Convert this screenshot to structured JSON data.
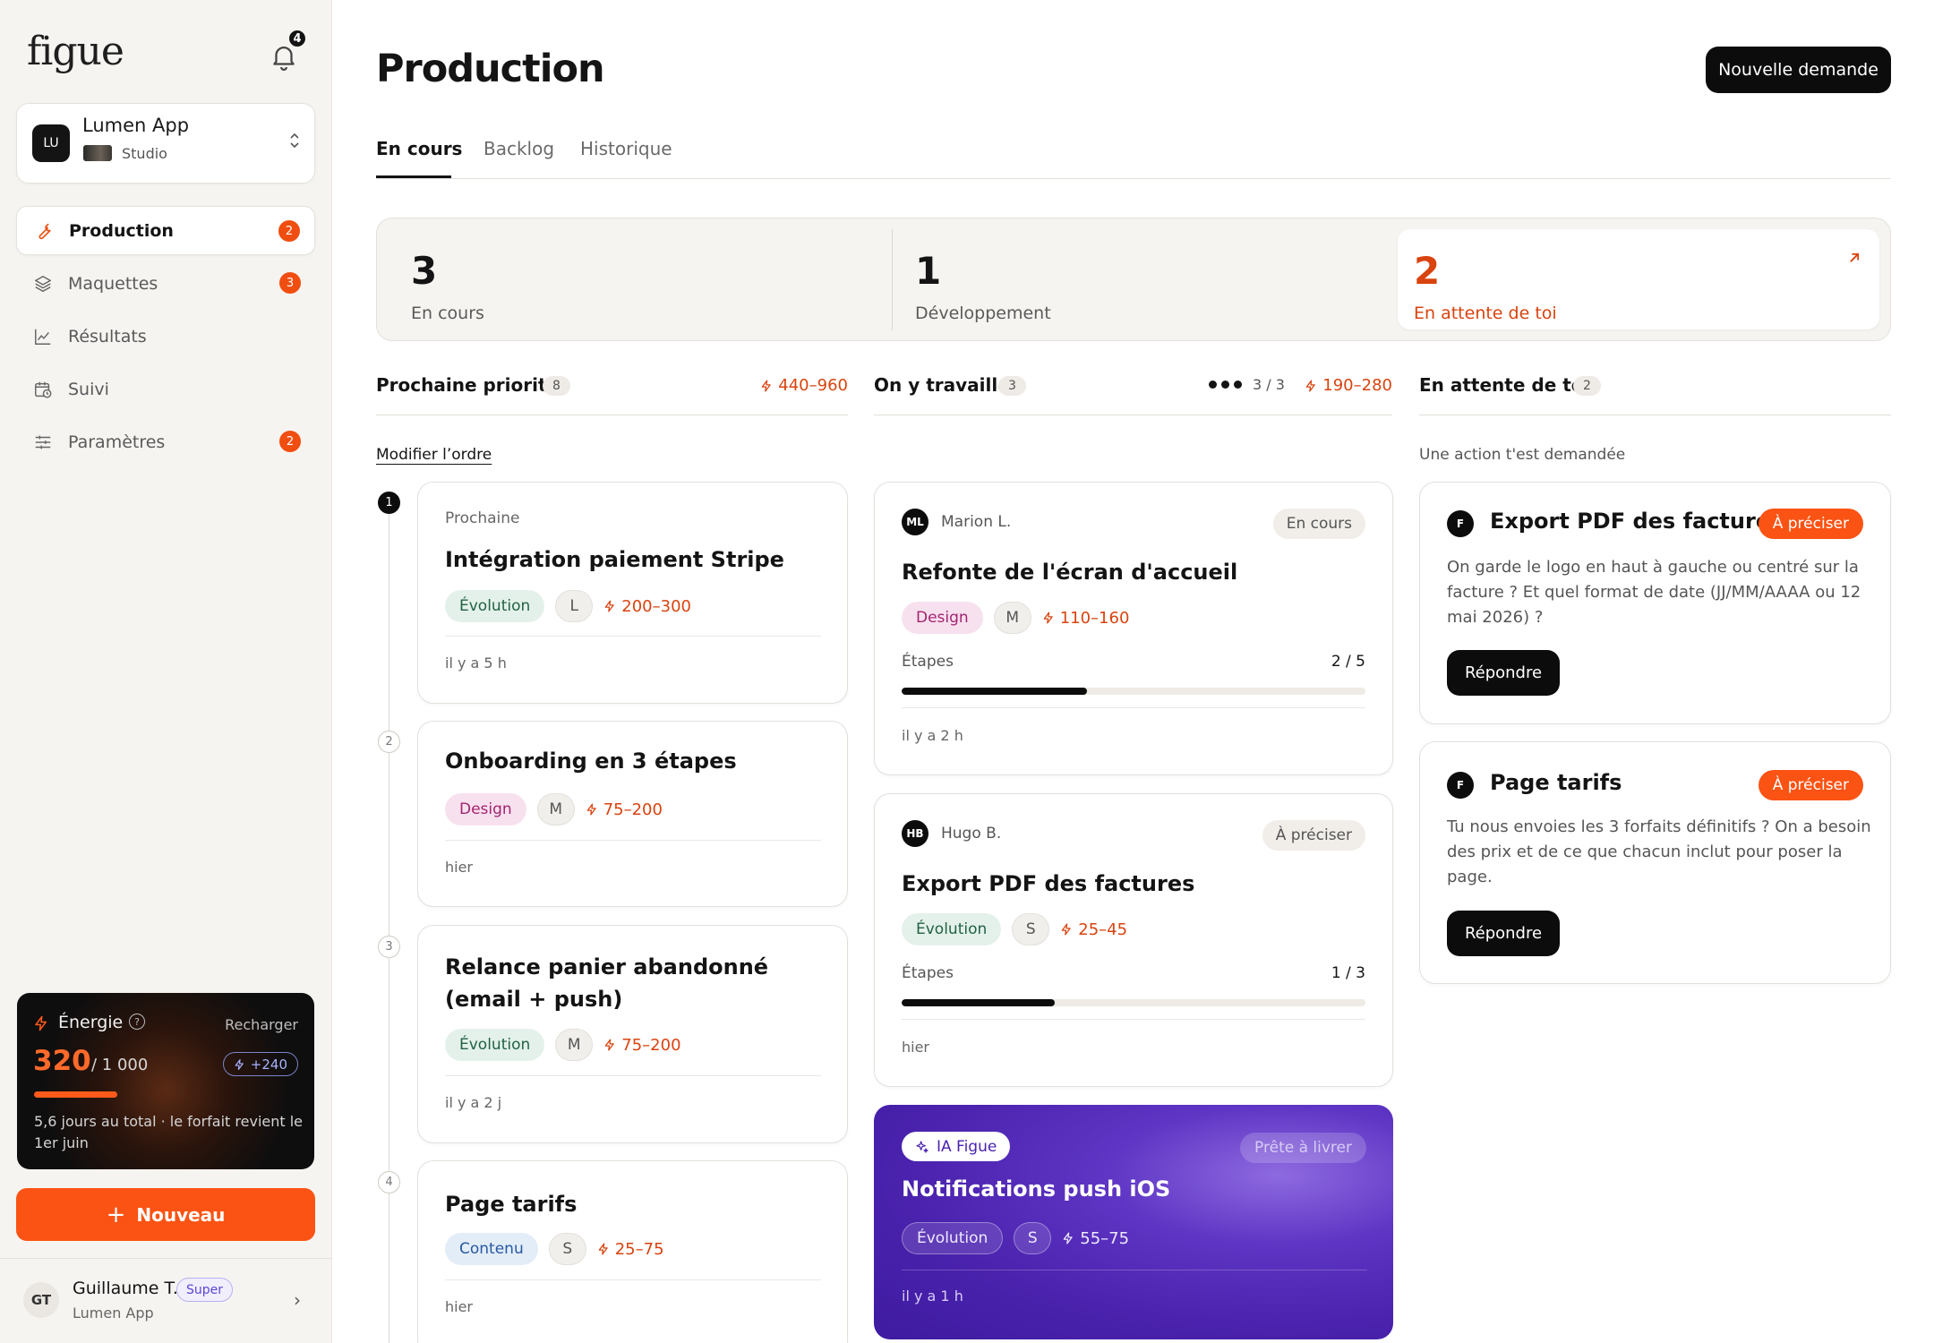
{
  "app": {
    "logo": "figue",
    "notifications_count": "4"
  },
  "workspace": {
    "initials": "LU",
    "name": "Lumen App",
    "plan": "Studio"
  },
  "sidebar": {
    "items": [
      {
        "label": "Production",
        "icon": "wrench-icon",
        "badge": "2",
        "active": true
      },
      {
        "label": "Maquettes",
        "icon": "layers-icon",
        "badge": "3"
      },
      {
        "label": "Résultats",
        "icon": "chart-icon",
        "badge": ""
      },
      {
        "label": "Suivi",
        "icon": "calendar-clock-icon",
        "badge": ""
      },
      {
        "label": "Paramètres",
        "icon": "sliders-icon",
        "badge": "2"
      }
    ]
  },
  "energy": {
    "title": "Énergie",
    "recharge": "Recharger",
    "value": "320",
    "max": "/ 1 000",
    "bonus": "+240",
    "level_fraction": 0.32,
    "note": "5,6 jours au total · le forfait revient le 1er juin"
  },
  "new_button": "Nouveau",
  "user": {
    "initials": "GT",
    "name": "Guillaume T.",
    "tag": "Super",
    "org": "Lumen App"
  },
  "page": {
    "title": "Production",
    "primary_action": "Nouvelle demande",
    "tabs": [
      "En cours",
      "Backlog",
      "Historique"
    ]
  },
  "stats": [
    {
      "value": "3",
      "label": "En cours"
    },
    {
      "value": "1",
      "label": "Développement"
    },
    {
      "value": "2",
      "label": "En attente de toi"
    }
  ],
  "columns": {
    "next": {
      "title": "Prochaine priorité",
      "count": "8",
      "range": "440–960",
      "action": "Modifier l’ordre",
      "cards": [
        {
          "rank": "1",
          "kicker": "Prochaine",
          "title": "Intégration paiement Stripe",
          "type": "Évolution",
          "size": "L",
          "range": "200–300",
          "time": "il y a 5 h"
        },
        {
          "rank": "2",
          "title": "Onboarding en 3 étapes",
          "type": "Design",
          "size": "M",
          "range": "75–200",
          "time": "hier"
        },
        {
          "rank": "3",
          "title": "Relance panier abandonné (email + push)",
          "type": "Évolution",
          "size": "M",
          "range": "75–200",
          "time": "il y a 2 j"
        },
        {
          "rank": "4",
          "title": "Page tarifs",
          "type": "Contenu",
          "size": "S",
          "range": "25–75",
          "time": "hier"
        }
      ]
    },
    "working": {
      "title": "On y travaille",
      "count": "3",
      "progress": "3 / 3",
      "range": "190–280",
      "cards": [
        {
          "initials": "ML",
          "person": "Marion L.",
          "status": "En cours",
          "title": "Refonte de l'écran d'accueil",
          "type": "Design",
          "size": "M",
          "range": "110–160",
          "steps_label": "Étapes",
          "steps": "2 / 5",
          "steps_fraction": 0.4,
          "time": "il y a 2 h"
        },
        {
          "initials": "HB",
          "person": "Hugo B.",
          "status": "À préciser",
          "title": "Export PDF des factures",
          "type": "Évolution",
          "size": "S",
          "range": "25–45",
          "steps_label": "Étapes",
          "steps": "1 / 3",
          "steps_fraction": 0.33,
          "time": "hier"
        }
      ],
      "ai_card": {
        "badge": "IA Figue",
        "status": "Prête à livrer",
        "title": "Notifications push iOS",
        "type": "Évolution",
        "size": "S",
        "range": "55–75",
        "time": "il y a 1 h"
      }
    },
    "waiting": {
      "title": "En attente de toi",
      "count": "2",
      "subtitle": "Une action t'est demandée",
      "cards": [
        {
          "initials": "F",
          "title": "Export PDF des factures",
          "status": "À préciser",
          "body": "On garde le logo en haut à gauche ou centré sur la facture ? Et quel format de date (JJ/MM/AAAA ou 12 mai 2026) ?",
          "action": "Répondre"
        },
        {
          "initials": "F",
          "title": "Page tarifs",
          "status": "À préciser",
          "body": "Tu nous envoies les 3 forfaits définitifs ? On a besoin des prix et de ce que chacun inclut pour poser la page.",
          "action": "Répondre"
        }
      ]
    }
  }
}
